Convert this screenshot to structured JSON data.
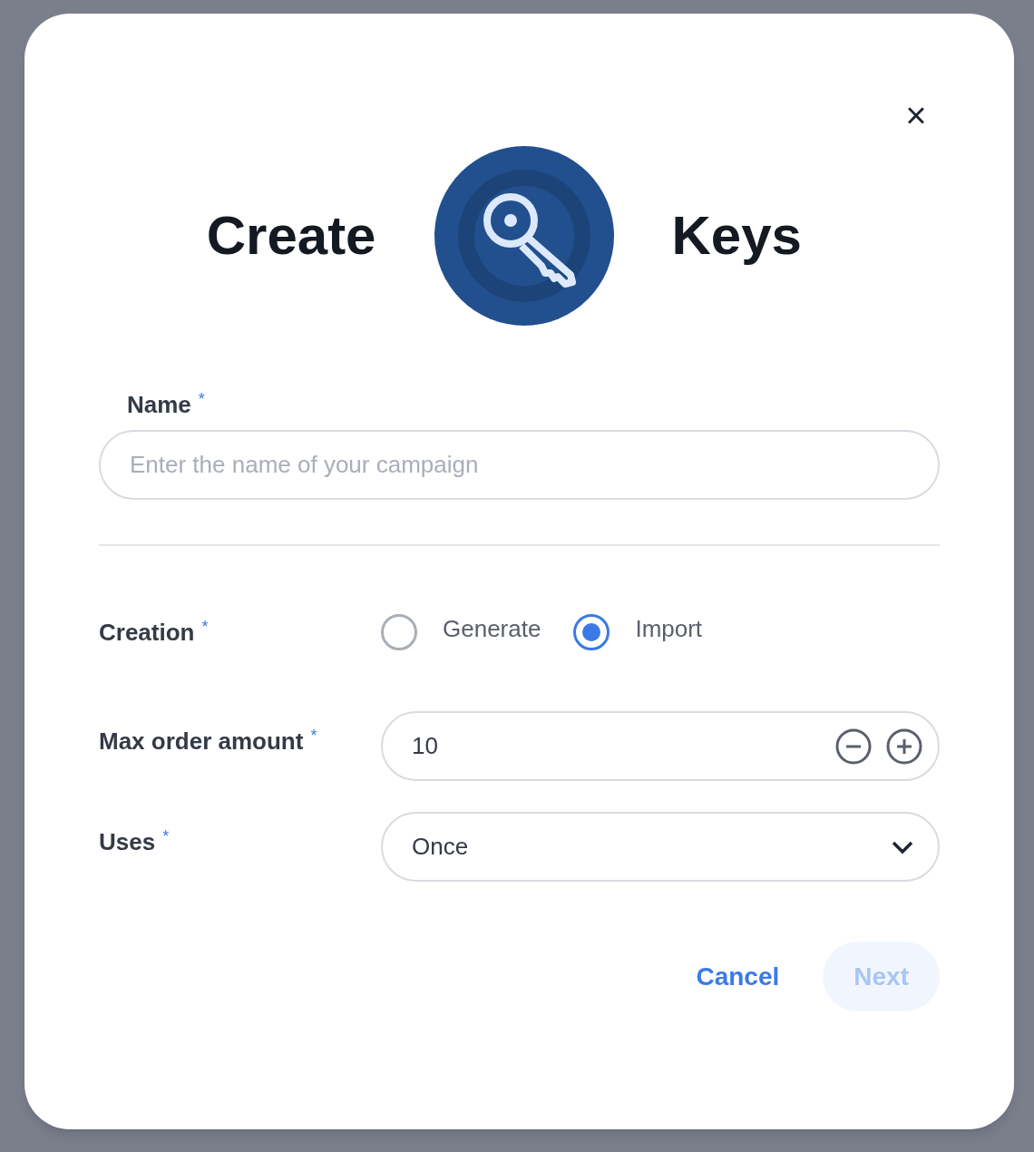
{
  "dialog": {
    "title_left": "Create",
    "title_right": "Keys",
    "close": "×"
  },
  "name_field": {
    "label": "Name",
    "mark": "*",
    "placeholder": "Enter the name of your campaign"
  },
  "creation": {
    "label": "Creation",
    "mark": "*",
    "options": [
      {
        "label": "Generate",
        "selected": false
      },
      {
        "label": "Import",
        "selected": true
      }
    ]
  },
  "max_order_amount": {
    "label": "Max order amount",
    "mark": "*",
    "value": "10"
  },
  "uses": {
    "label": "Uses",
    "mark": "*",
    "value": "Once"
  },
  "buttons": [
    {
      "label": "Cancel",
      "kind": "text",
      "disabled": false
    },
    {
      "label": "Next",
      "kind": "pill",
      "disabled": true
    }
  ]
}
